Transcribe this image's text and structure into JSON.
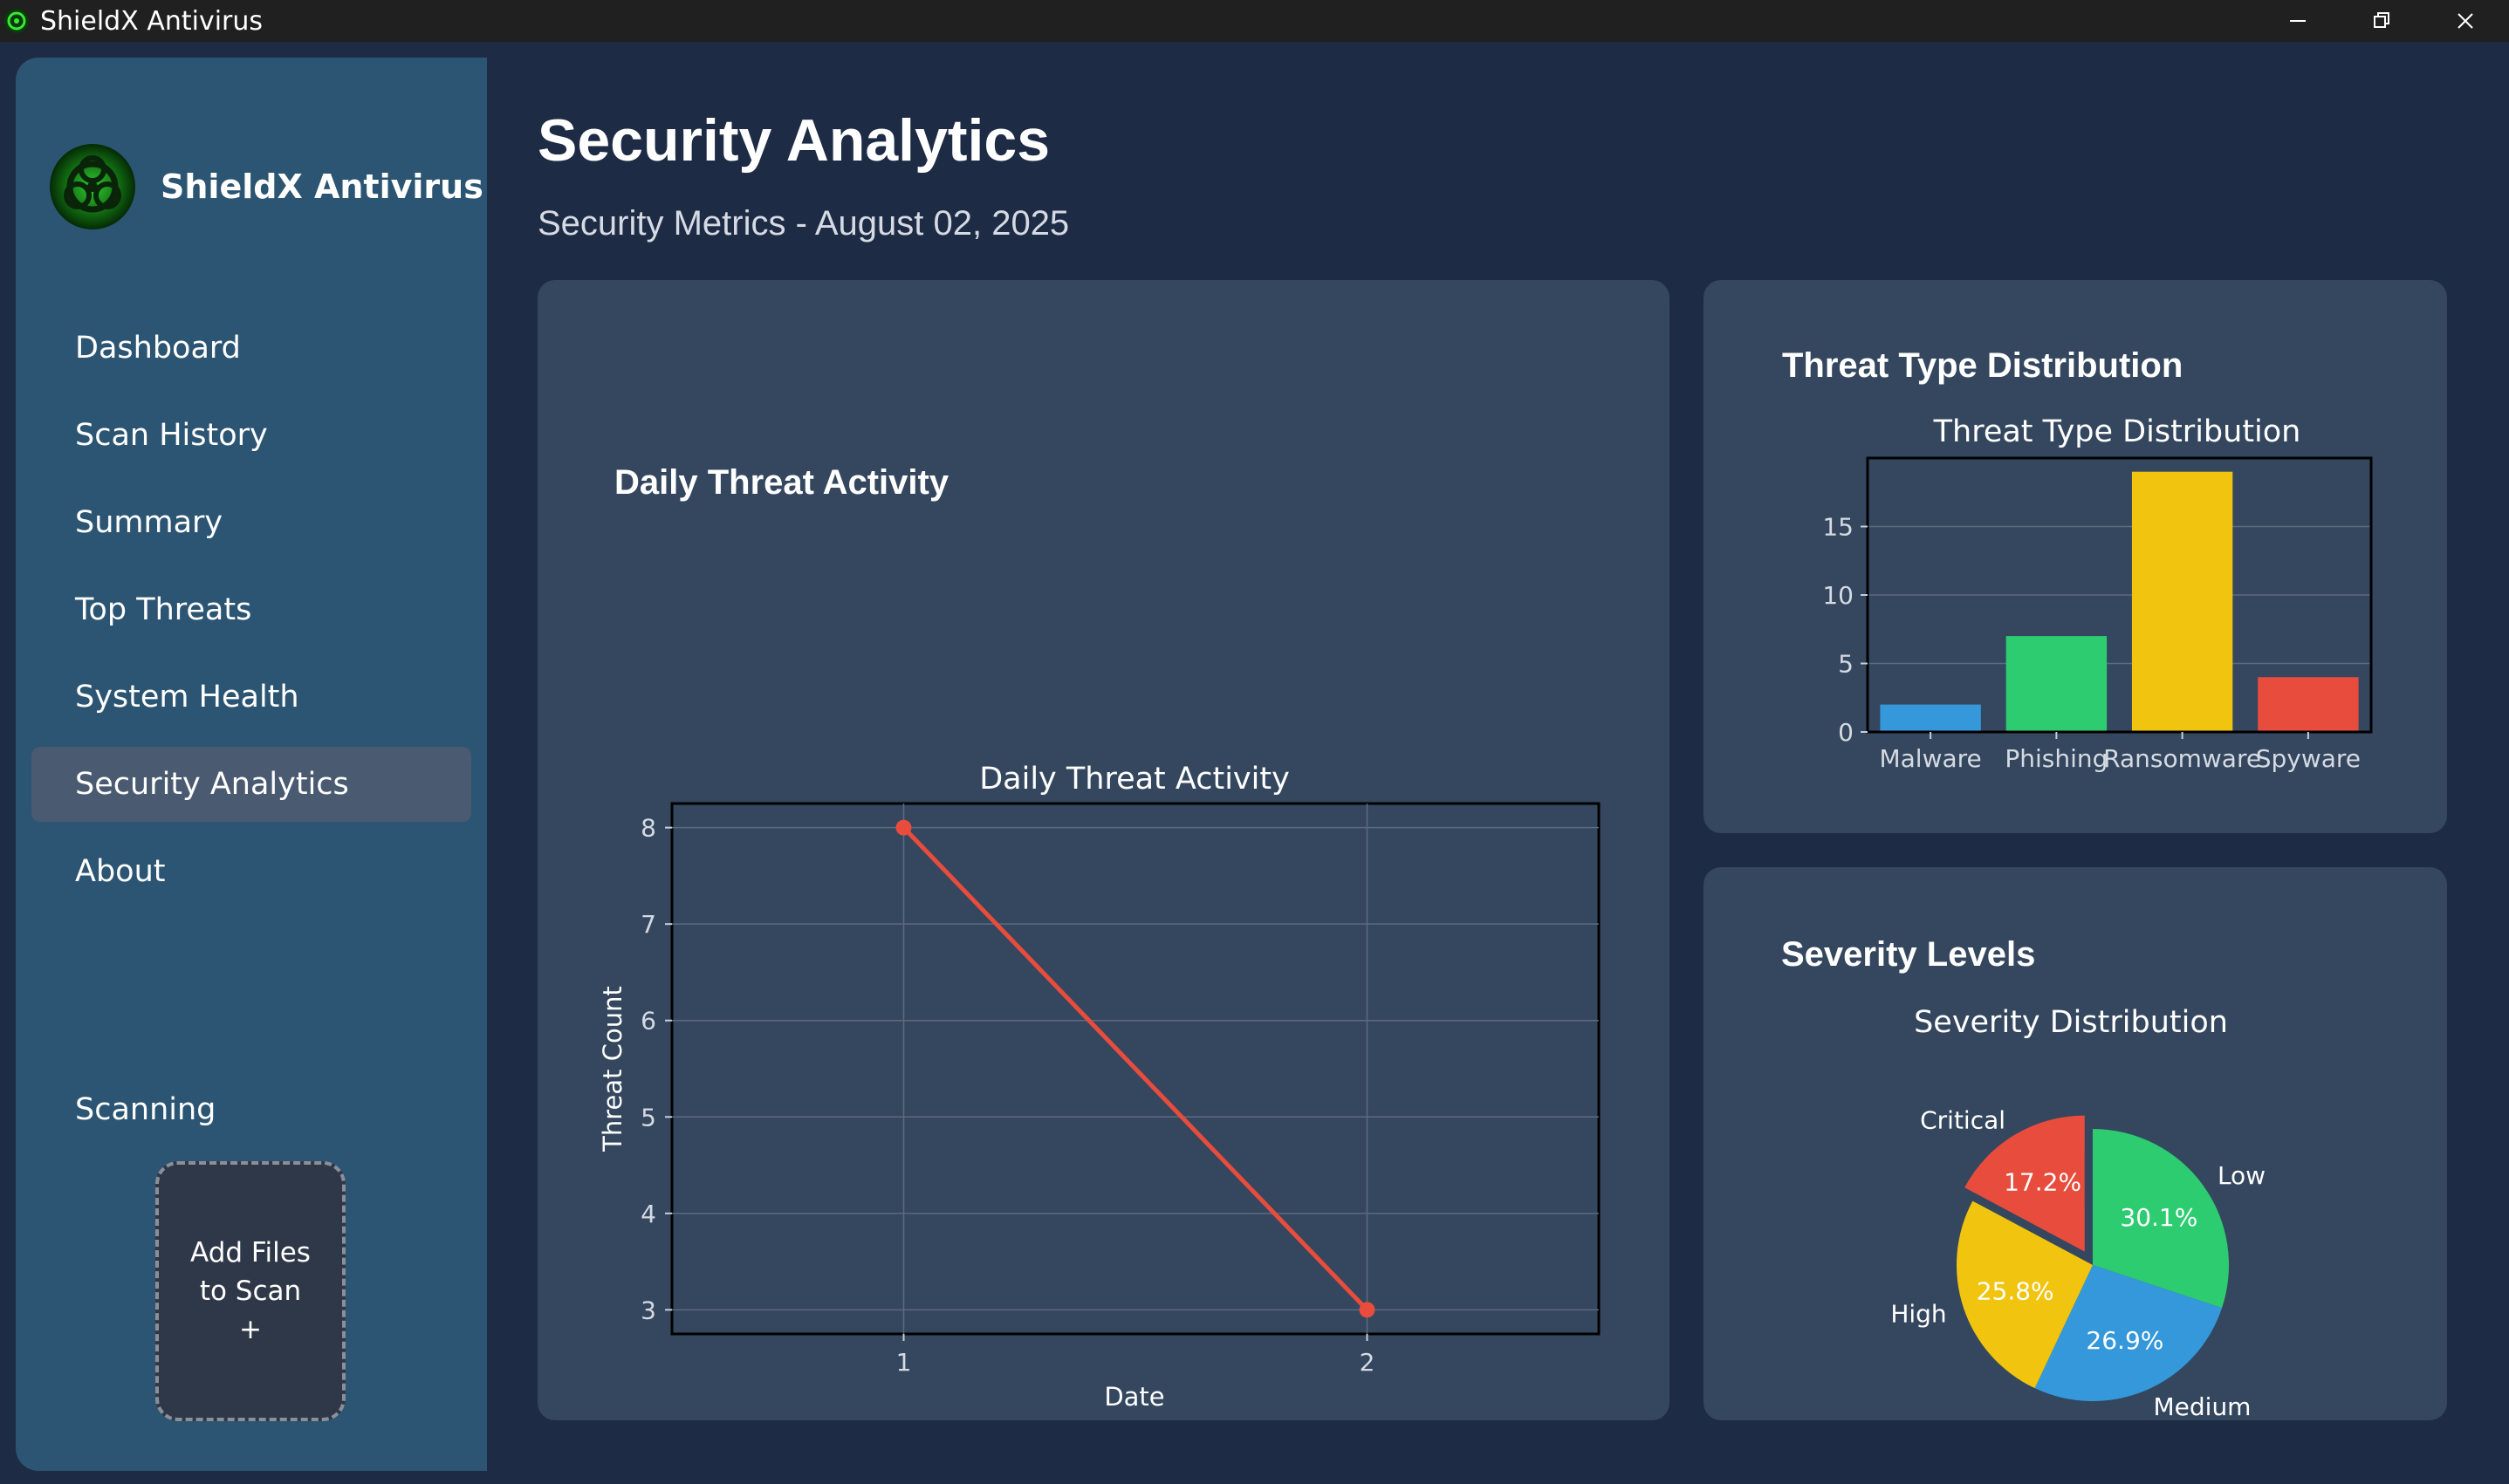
{
  "window": {
    "title": "ShieldX Antivirus"
  },
  "sidebar": {
    "brand_name": "ShieldX Antivirus",
    "items": [
      {
        "label": "Dashboard",
        "active": false
      },
      {
        "label": "Scan History",
        "active": false
      },
      {
        "label": "Summary",
        "active": false
      },
      {
        "label": "Top Threats",
        "active": false
      },
      {
        "label": "System Health",
        "active": false
      },
      {
        "label": "Security Analytics",
        "active": true
      },
      {
        "label": "About",
        "active": false
      }
    ],
    "scanning_label": "Scanning",
    "dropzone": {
      "line1": "Add Files",
      "line2": "to Scan",
      "line3": "+"
    }
  },
  "main": {
    "title": "Security Analytics",
    "subtitle": "Security Metrics - August 02, 2025",
    "daily_card_title": "Daily Threat Activity",
    "threat_card_title": "Threat Type Distribution",
    "severity_card_title": "Severity Levels"
  },
  "colors": {
    "blue": "#3498db",
    "green": "#2ecc71",
    "yellow": "#f1c40f",
    "red": "#e74c3c"
  },
  "chart_data": [
    {
      "type": "line",
      "title": "Daily Threat Activity",
      "xlabel": "Date",
      "ylabel": "Threat Count",
      "x": [
        1,
        2
      ],
      "y": [
        8,
        3
      ],
      "x_ticks": [
        "1",
        "2"
      ],
      "y_ticks": [
        3,
        4,
        5,
        6,
        7,
        8
      ],
      "xlim": [
        0.5,
        2.5
      ],
      "ylim": [
        2.75,
        8.25
      ],
      "grid": true,
      "color": "#e74c3c"
    },
    {
      "type": "bar",
      "title": "Threat Type Distribution",
      "categories": [
        "Malware",
        "Phishing",
        "Ransomware",
        "Spyware"
      ],
      "values": [
        2,
        7,
        19,
        4
      ],
      "colors": [
        "#3498db",
        "#2ecc71",
        "#f1c40f",
        "#e74c3c"
      ],
      "y_ticks": [
        0,
        5,
        10,
        15
      ],
      "ylim": [
        0,
        20
      ],
      "grid": true
    },
    {
      "type": "pie",
      "title": "Severity Distribution",
      "slices": [
        {
          "label": "Low",
          "pct": 30.1,
          "pct_label": "30.1%",
          "color": "#2ecc71"
        },
        {
          "label": "Medium",
          "pct": 26.9,
          "pct_label": "26.9%",
          "color": "#3498db"
        },
        {
          "label": "High",
          "pct": 25.8,
          "pct_label": "25.8%",
          "color": "#f1c40f"
        },
        {
          "label": "Critical",
          "pct": 17.2,
          "pct_label": "17.2%",
          "color": "#e74c3c",
          "exploded": true
        }
      ]
    }
  ]
}
